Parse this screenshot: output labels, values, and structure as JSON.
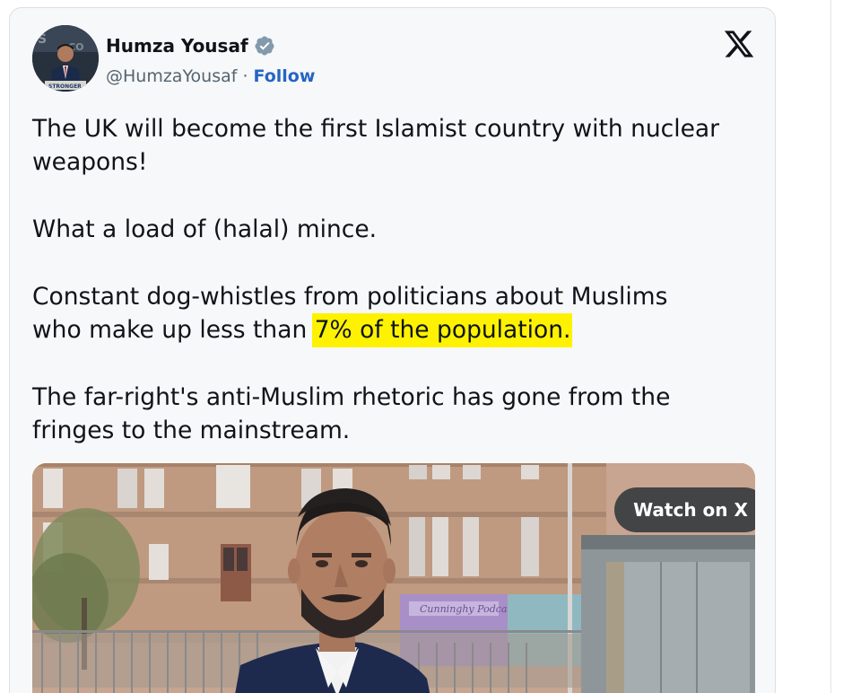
{
  "tweet": {
    "author": {
      "display_name": "Humza Yousaf",
      "handle": "@HumzaYousaf",
      "separator": "·",
      "follow_label": "Follow",
      "verified_icon": "verified-badge-icon",
      "avatar_icon": "profile-photo"
    },
    "platform_icon": "x-logo-icon",
    "paragraphs": [
      {
        "lines": [
          "The UK will become the first Islamist country with nuclear",
          "weapons!"
        ]
      },
      {
        "lines": [
          "What a load of (halal) mince."
        ]
      },
      {
        "lines": [
          "Constant dog-whistles from politicians about Muslims"
        ],
        "line2_prefix": "who make up less than ",
        "line2_highlight": "7% of the population."
      },
      {
        "lines": [
          "The far-right's anti-Muslim rhetoric has gone from the",
          "fringes to the mainstream."
        ]
      }
    ],
    "highlight_color": "#fef200",
    "media": {
      "watch_label": "Watch on X",
      "thumbnail": "video-thumbnail-man-street"
    }
  },
  "colors": {
    "card_background": "#f7f8f9",
    "text_primary": "#0f1419",
    "text_secondary": "#536471",
    "link": "#2565c4",
    "verified": "#829aab"
  }
}
